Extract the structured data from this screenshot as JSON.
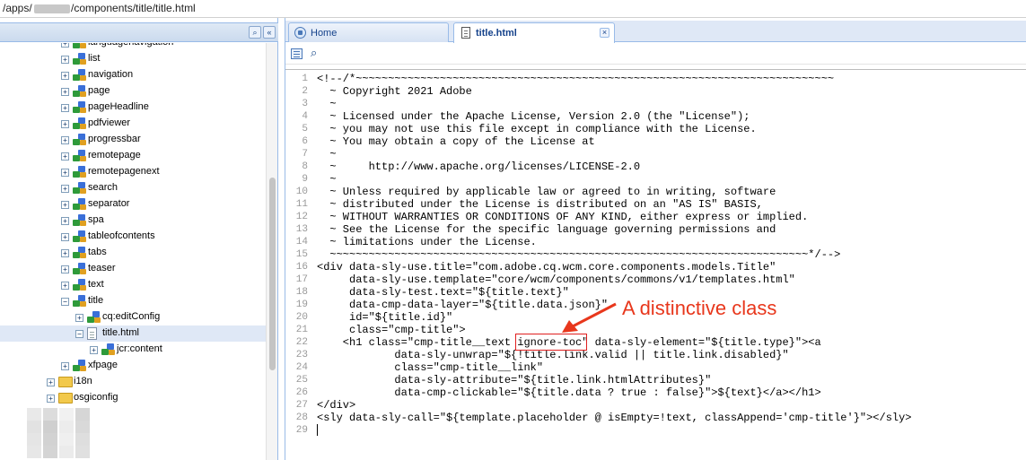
{
  "path": {
    "prefix": "/apps/",
    "suffix": "/components/title/title.html"
  },
  "tree": {
    "items": [
      {
        "label": "languagenavigation",
        "icon": "component",
        "expander": "+"
      },
      {
        "label": "list",
        "icon": "component",
        "expander": "+"
      },
      {
        "label": "navigation",
        "icon": "component",
        "expander": "+"
      },
      {
        "label": "page",
        "icon": "component",
        "expander": "+"
      },
      {
        "label": "pageHeadline",
        "icon": "component",
        "expander": "+"
      },
      {
        "label": "pdfviewer",
        "icon": "component",
        "expander": "+"
      },
      {
        "label": "progressbar",
        "icon": "component",
        "expander": "+"
      },
      {
        "label": "remotepage",
        "icon": "component",
        "expander": "+"
      },
      {
        "label": "remotepagenext",
        "icon": "component",
        "expander": "+"
      },
      {
        "label": "search",
        "icon": "component",
        "expander": "+"
      },
      {
        "label": "separator",
        "icon": "component",
        "expander": "+"
      },
      {
        "label": "spa",
        "icon": "component",
        "expander": "+"
      },
      {
        "label": "tableofcontents",
        "icon": "component",
        "expander": "+"
      },
      {
        "label": "tabs",
        "icon": "component",
        "expander": "+"
      },
      {
        "label": "teaser",
        "icon": "component",
        "expander": "+"
      },
      {
        "label": "text",
        "icon": "component",
        "expander": "+"
      },
      {
        "label": "title",
        "icon": "component",
        "expander": "−"
      },
      {
        "label": "cq:editConfig",
        "icon": "component",
        "expander": "+"
      },
      {
        "label": "title.html",
        "icon": "file",
        "expander": "−",
        "selected": true
      },
      {
        "label": "jcr:content",
        "icon": "component",
        "expander": "+"
      },
      {
        "label": "xfpage",
        "icon": "component",
        "expander": "+"
      },
      {
        "label": "i18n",
        "icon": "folder",
        "expander": "+"
      },
      {
        "label": "osgiconfig",
        "icon": "folder",
        "expander": "+"
      }
    ]
  },
  "tabs": [
    {
      "label": "Home",
      "icon": "home-icon",
      "active": false
    },
    {
      "label": "title.html",
      "icon": "document-icon",
      "active": true,
      "close": "×"
    }
  ],
  "editor": {
    "line_numbers": [
      "1",
      "2",
      "3",
      "4",
      "5",
      "6",
      "7",
      "8",
      "9",
      "10",
      "11",
      "12",
      "13",
      "14",
      "15",
      "16",
      "17",
      "18",
      "19",
      "20",
      "21",
      "22",
      "23",
      "24",
      "25",
      "26",
      "27",
      "28",
      "29"
    ],
    "lines": [
      "<!--/*~~~~~~~~~~~~~~~~~~~~~~~~~~~~~~~~~~~~~~~~~~~~~~~~~~~~~~~~~~~~~~~~~~~~~~~~~~",
      "  ~ Copyright 2021 Adobe",
      "  ~",
      "  ~ Licensed under the Apache License, Version 2.0 (the \"License\");",
      "  ~ you may not use this file except in compliance with the License.",
      "  ~ You may obtain a copy of the License at",
      "  ~",
      "  ~     http://www.apache.org/licenses/LICENSE-2.0",
      "  ~",
      "  ~ Unless required by applicable law or agreed to in writing, software",
      "  ~ distributed under the License is distributed on an \"AS IS\" BASIS,",
      "  ~ WITHOUT WARRANTIES OR CONDITIONS OF ANY KIND, either express or implied.",
      "  ~ See the License for the specific language governing permissions and",
      "  ~ limitations under the License.",
      "  ~~~~~~~~~~~~~~~~~~~~~~~~~~~~~~~~~~~~~~~~~~~~~~~~~~~~~~~~~~~~~~~~~~~~~~~~~~*/-->",
      "<div data-sly-use.title=\"com.adobe.cq.wcm.core.components.models.Title\"",
      "     data-sly-use.template=\"core/wcm/components/commons/v1/templates.html\"",
      "     data-sly-test.text=\"${title.text}\"",
      "     data-cmp-data-layer=\"${title.data.json}\"",
      "     id=\"${title.id}\"",
      "     class=\"cmp-title\">",
      "    <h1 class=\"cmp-title__text ignore-toc\" data-sly-element=\"${title.type}\"><a",
      "            data-sly-unwrap=\"${!title.link.valid || title.link.disabled}\"",
      "            class=\"cmp-title__link\"",
      "            data-sly-attribute=\"${title.link.htmlAttributes}\"",
      "            data-cmp-clickable=\"${title.data ? true : false}\">${text}</a></h1>",
      "</div>",
      "<sly data-sly-call=\"${template.placeholder @ isEmpty=!text, classAppend='cmp-title'}\"></sly>",
      ""
    ]
  },
  "annotation": {
    "label": "A distinctive class",
    "color": "#e8371c"
  }
}
